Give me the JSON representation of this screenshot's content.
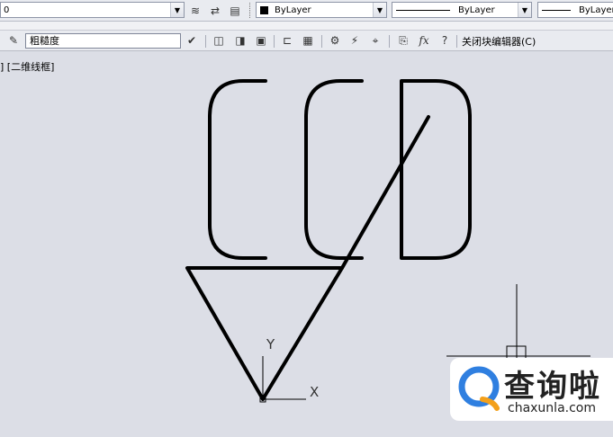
{
  "toolbar_top": {
    "left_combo_value": "0",
    "color_combo_value": "ByLayer",
    "linetype_combo_value": "ByLayer",
    "lineweight_combo_value": "ByLayer"
  },
  "toolbar_block": {
    "parameter_input_value": "粗糙度",
    "close_block_editor_label": "关闭块编辑器(C)",
    "fx_label": "fx"
  },
  "viewport": {
    "label": "]  [二维线框]"
  },
  "ucs": {
    "x_label": "X",
    "y_label": "Y"
  },
  "watermark": {
    "title": "查询啦",
    "url": "chaxunla.com"
  },
  "colors": {
    "canvas_bg": "#dcdee6",
    "toolbar_bg": "#e9ebf0",
    "logo_blue": "#2f7fe0",
    "logo_orange": "#f3a01b"
  }
}
